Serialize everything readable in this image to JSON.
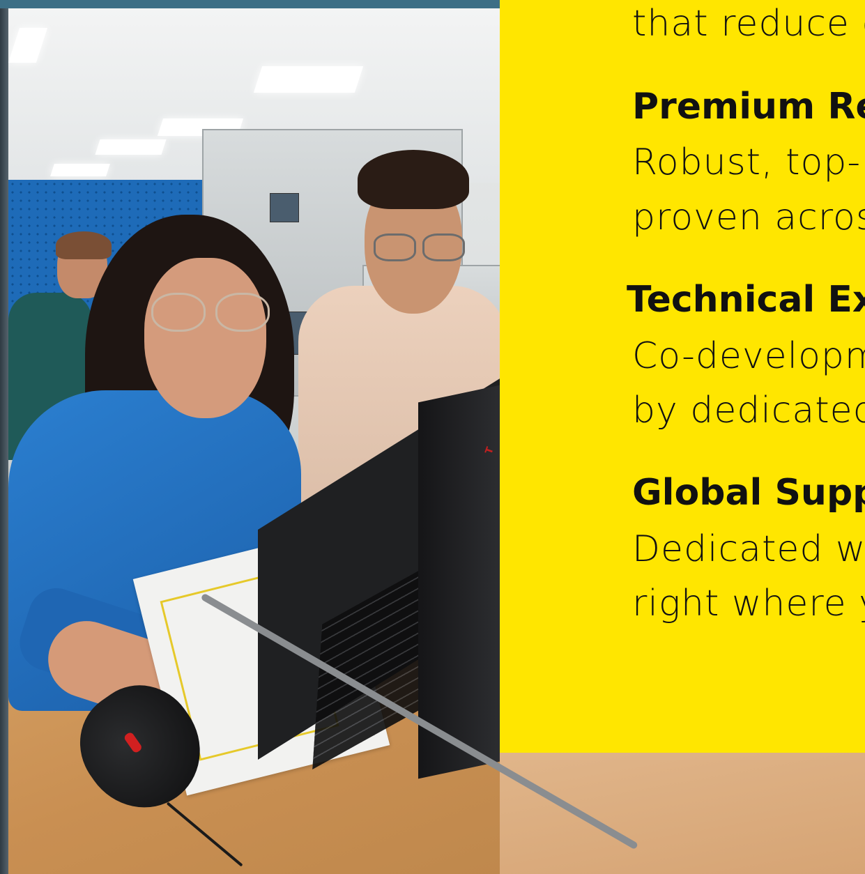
{
  "colors": {
    "card_background": "#ffe600",
    "text": "#111111",
    "accent_blue": "#1e6bb8",
    "mouse_accent": "#d12020"
  },
  "photo": {
    "subjects": [
      "woman-blue-shirt",
      "man-beige-shirt",
      "background-worker"
    ],
    "laptop_brand_mark": "T"
  },
  "info_card": {
    "intro_line": "that reduce e",
    "features": [
      {
        "title": "Premium Re",
        "lines": [
          "Robust, top-",
          "proven acros"
        ]
      },
      {
        "title": "Technical Ex",
        "lines": [
          "Co-developm",
          "by dedicated"
        ]
      },
      {
        "title": "Global Supp",
        "lines": [
          "Dedicated w",
          "right where y"
        ]
      }
    ]
  }
}
